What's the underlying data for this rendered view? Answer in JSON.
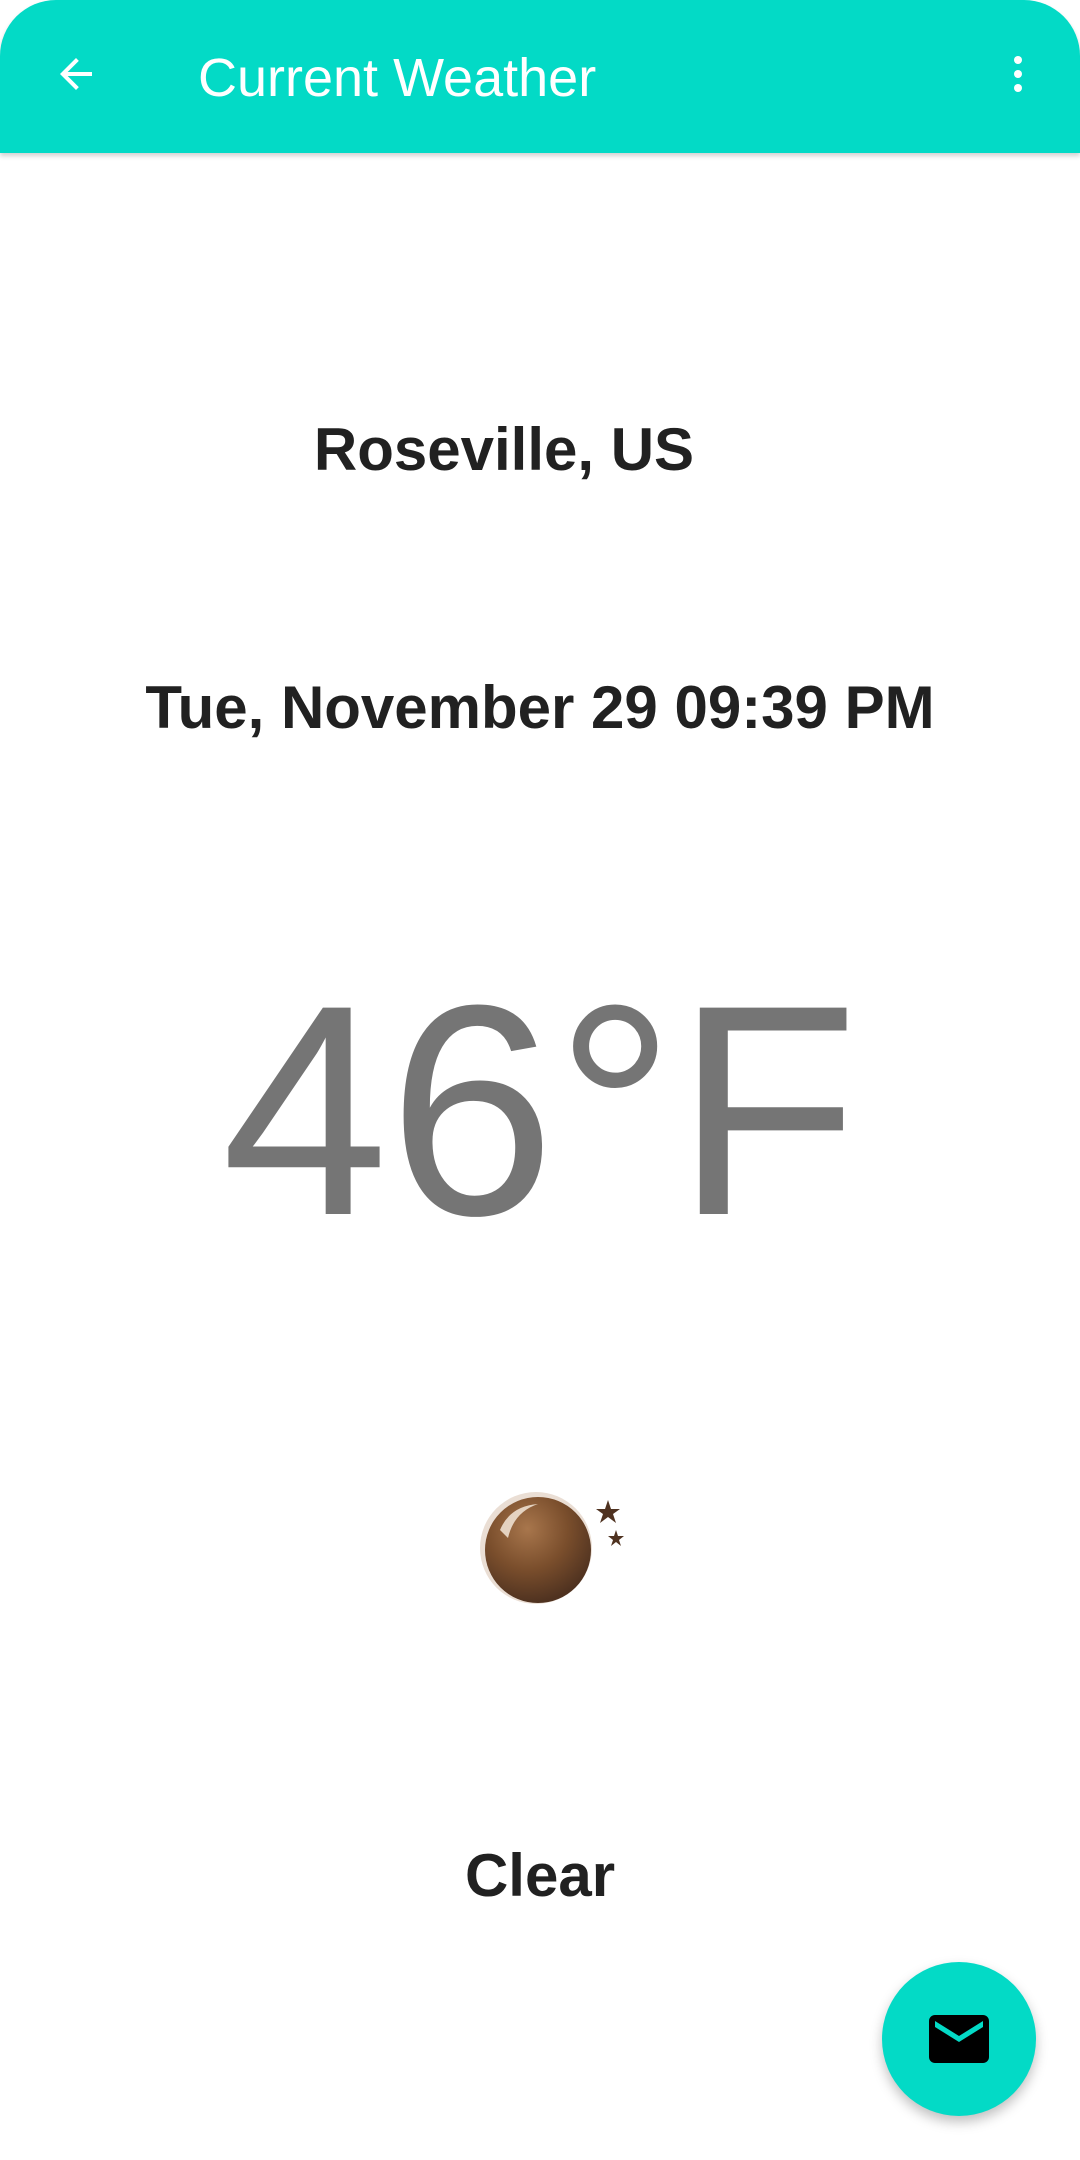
{
  "app_bar": {
    "title": "Current Weather",
    "back_icon": "arrow-back-icon",
    "overflow_icon": "more-vert-icon",
    "color": "#03dac6"
  },
  "weather": {
    "location": "Roseville, US",
    "datetime": "Tue, November 29 09:39 PM",
    "temperature": "46°F",
    "condition_icon": "clear-night-moon-icon",
    "condition": "Clear"
  },
  "fab": {
    "icon": "mail-icon",
    "color": "#03dac6"
  }
}
